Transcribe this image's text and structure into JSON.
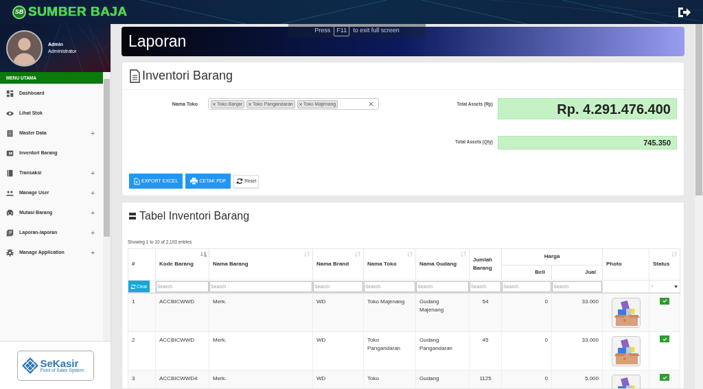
{
  "brand": {
    "logo": "SB",
    "name": "SUMBER BAJA"
  },
  "fullscreen_notice": {
    "before": "Press",
    "key": "F11",
    "after": "to exit full screen"
  },
  "user": {
    "name": "Admin",
    "role": "Administrator"
  },
  "sidebar": {
    "heading": "MENU UTAMA",
    "items": [
      {
        "label": "Dashboard"
      },
      {
        "label": "Lihat Stok"
      },
      {
        "label": "Master Data",
        "toggle": "+"
      },
      {
        "label": "Inventori Barang"
      },
      {
        "label": "Transaksi",
        "toggle": "+"
      },
      {
        "label": "Manage User",
        "toggle": "+"
      },
      {
        "label": "Mutasi Barang",
        "toggle": "+"
      },
      {
        "label": "Laporan-laporan",
        "toggle": "+"
      },
      {
        "label": "Manage Application",
        "toggle": "+"
      }
    ]
  },
  "footer_logo": {
    "name": "SeKasir",
    "tagline": "Point of Sales System"
  },
  "page_title": "Laporan",
  "inventory": {
    "title": "Inventori Barang",
    "store_label": "Nama Toko",
    "stores": [
      "Toko Banjar",
      "Toko Pangandaran",
      "Toko Majenang"
    ],
    "totals": [
      {
        "label": "Total Assets (Rp)",
        "value": "Rp. 4.291.476.400",
        "kind": "large"
      },
      {
        "label": "Total Assets (Qty)",
        "value": "745.350",
        "kind": "normal"
      }
    ],
    "buttons": [
      {
        "label": "EXPORT EXCEL",
        "kind": "excel"
      },
      {
        "label": "CETAK PDF",
        "kind": "print"
      },
      {
        "label": "Reset",
        "kind": "reset"
      }
    ]
  },
  "table": {
    "title": "Tabel Inventori Barang",
    "info": "Showing 1 to 10 of 2,103 entries",
    "columns": [
      {
        "label": "#",
        "filter": {
          "kind": "clear",
          "label": "Clear"
        }
      },
      {
        "label": "Kode Barang",
        "sorted": true,
        "filter": {
          "kind": "search",
          "placeholder": "Search"
        }
      },
      {
        "label": "Nama Barang",
        "sorted": false,
        "filter": {
          "kind": "search",
          "placeholder": "Search"
        }
      },
      {
        "label": "Nama Brand",
        "sorted": false,
        "filter": {
          "kind": "search",
          "placeholder": "Search"
        }
      },
      {
        "label": "Nama Toko",
        "sorted": false,
        "filter": {
          "kind": "search",
          "placeholder": "Search"
        }
      },
      {
        "label": "Nama Gudang",
        "sorted": false,
        "filter": {
          "kind": "search",
          "placeholder": "Search"
        }
      },
      {
        "label": "Jumlah Barang",
        "filter": {
          "kind": "search",
          "placeholder": "Search"
        }
      },
      {
        "label": "Harga",
        "children": [
          {
            "label": "Beli",
            "filter": {
              "kind": "search",
              "placeholder": "Search"
            }
          },
          {
            "label": "Jual",
            "filter": {
              "kind": "search",
              "placeholder": "Search"
            }
          }
        ]
      },
      {
        "label": "Photo"
      },
      {
        "label": "Status",
        "sorted": false,
        "filter": {
          "kind": "select",
          "value": "-"
        }
      }
    ],
    "rows": [
      {
        "no": "1",
        "code": "ACCBICWWD",
        "name": "Merk.",
        "brand": "WD",
        "store": "Toko Majenang",
        "warehouse": "Gudang Majenang",
        "qty": "54",
        "buy": "0",
        "sell": "33.000",
        "active": true
      },
      {
        "no": "2",
        "code": "ACCBICWWD",
        "name": "Merk.",
        "brand": "WD",
        "store": "Toko Pangandaran",
        "warehouse": "Gudang Pangandaran",
        "qty": "45",
        "buy": "0",
        "sell": "33.000",
        "active": true
      },
      {
        "no": "3",
        "code": "ACCBICWWD4",
        "name": "Merk.",
        "brand": "WD",
        "store": "Toko",
        "warehouse": "Gudang",
        "qty": "1125",
        "buy": "0",
        "sell": "5.000",
        "active": true
      }
    ]
  }
}
